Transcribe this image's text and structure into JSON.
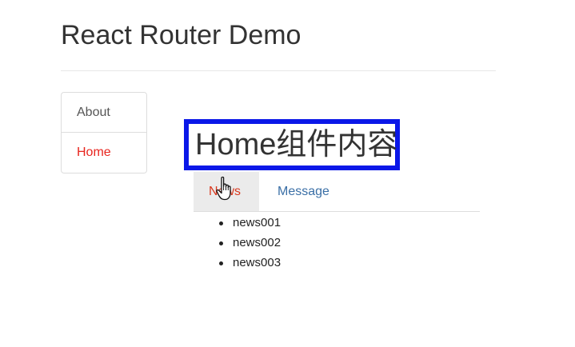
{
  "header": {
    "title": "React Router Demo"
  },
  "sidebar": {
    "items": [
      {
        "label": "About",
        "active": false
      },
      {
        "label": "Home",
        "active": true
      }
    ]
  },
  "home": {
    "heading": "Home组件内容",
    "heading_border_color": "#0a17e8",
    "tabs": [
      {
        "label": "News",
        "active": true
      },
      {
        "label": "Message",
        "active": false
      }
    ],
    "news": [
      "news001",
      "news002",
      "news003"
    ]
  },
  "colors": {
    "active_link": "#e8251e",
    "inactive_link": "#3a6fa6",
    "text": "#333333"
  },
  "cursor": "hand-pointer-icon"
}
